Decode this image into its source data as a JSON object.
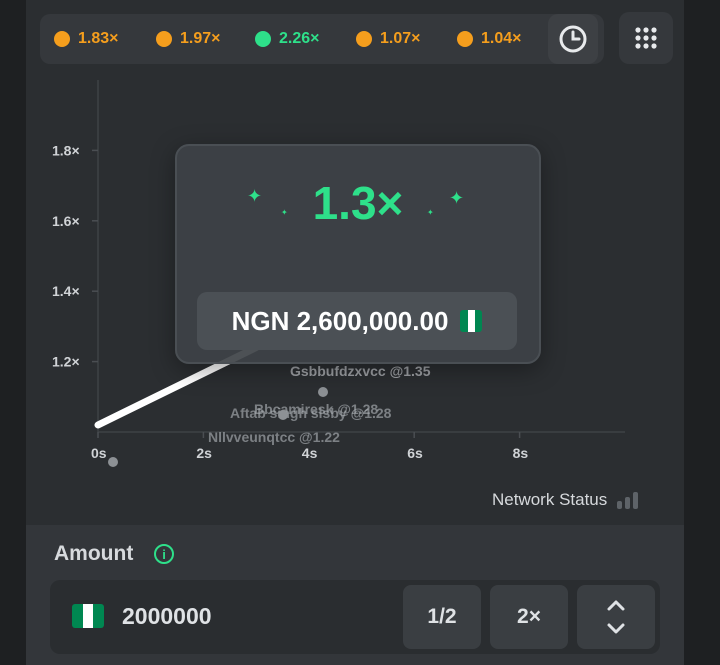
{
  "history": [
    {
      "value": "1.83×",
      "color": "#f59e1d"
    },
    {
      "value": "1.97×",
      "color": "#f59e1d"
    },
    {
      "value": "2.26×",
      "color": "#2ee08a"
    },
    {
      "value": "1.07×",
      "color": "#f59e1d"
    },
    {
      "value": "1.04×",
      "color": "#f59e1d"
    }
  ],
  "icons": {
    "history": "clock-icon",
    "menu": "grid-menu-icon",
    "info": "info-icon",
    "stepper": "chevron-up-down-icon",
    "network": "signal-bars-icon",
    "flag": "nigeria-flag-icon"
  },
  "chart_data": {
    "type": "line",
    "x_ticks": [
      "0s",
      "2s",
      "4s",
      "6s",
      "8s"
    ],
    "y_ticks": [
      "1.8×",
      "1.6×",
      "1.4×",
      "1.2×"
    ],
    "xlim": [
      0,
      10
    ],
    "ylim": [
      1.0,
      2.0
    ],
    "series": [
      {
        "x": [
          0,
          3
        ],
        "y": [
          1.02,
          1.24
        ]
      }
    ],
    "players": [
      {
        "label": "Gsbbufdzxvcc @1.35"
      },
      {
        "label": "Bbcamiresk @1.28"
      },
      {
        "label": "Aftab singh sisby @1.28"
      },
      {
        "label": "Nllvveunqtcc @1.22"
      }
    ]
  },
  "result": {
    "multiplier": "1.3×",
    "payout": "NGN 2,600,000.00"
  },
  "network_status": "Network Status",
  "amount": {
    "label": "Amount",
    "value": "2000000",
    "half_label": "1/2",
    "double_label": "2×"
  },
  "colors": {
    "accent": "#2ee08a",
    "history_low": "#f59e1d",
    "flag_green": "#008751"
  }
}
